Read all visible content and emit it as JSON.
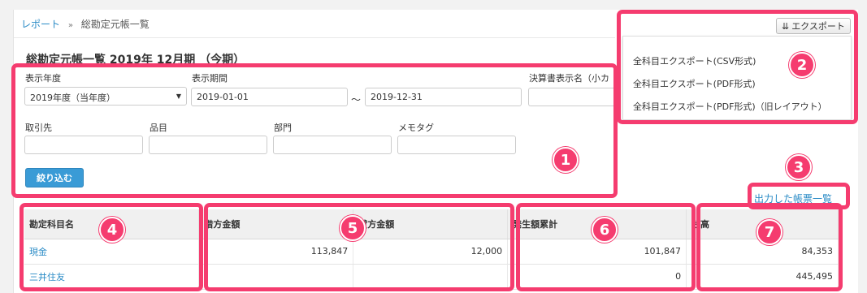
{
  "breadcrumb": {
    "root": "レポート",
    "separator": "»",
    "current": "総勘定元帳一覧"
  },
  "title": "総勘定元帳一覧 2019年 12月期 （今期）",
  "export": {
    "button_label": "エクスポート",
    "menu": [
      "全科目エクスポート(CSV形式)",
      "全科目エクスポート(PDF形式)",
      "全科目エクスポート(PDF形式)（旧レイアウト）"
    ]
  },
  "filters": {
    "year_label": "表示年度",
    "year_value": "2019年度（当年度）",
    "period_label": "表示期間",
    "period_from": "2019-01-01",
    "period_tilde": "～",
    "period_to": "2019-12-31",
    "statement_label": "決算書表示名（小カ",
    "partner_label": "取引先",
    "item_label": "品目",
    "dept_label": "部門",
    "memo_label": "メモタグ",
    "submit_label": "絞り込む"
  },
  "report_list_link": "出力した帳票一覧",
  "table": {
    "headers": [
      "勘定科目名",
      "借方金額",
      "貸方金額",
      "発生額累計",
      "残高"
    ],
    "rows": [
      [
        "現金",
        "113,847",
        "12,000",
        "101,847",
        "84,353"
      ],
      [
        "三井住友",
        "",
        "",
        "0",
        "445,495"
      ]
    ]
  },
  "annotations": [
    "1",
    "2",
    "3",
    "4",
    "5",
    "6",
    "7"
  ],
  "colors": {
    "highlight": "#f53c6f",
    "link": "#2a8bc6",
    "button": "#3a9bd6"
  }
}
